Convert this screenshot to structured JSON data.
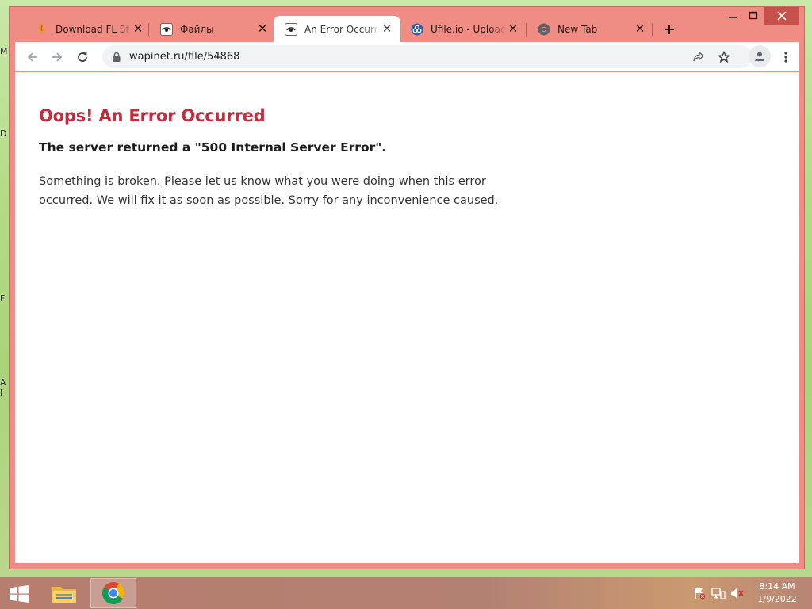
{
  "desktop": {
    "fragments": [
      "M",
      "D",
      "F",
      "A",
      "I"
    ]
  },
  "browser": {
    "tabs": [
      {
        "title": "Download FL Studio",
        "icon": "fl-studio-icon",
        "active": false
      },
      {
        "title": "Файлы",
        "icon": "wapinet-icon",
        "active": false
      },
      {
        "title": "An Error Occurred",
        "icon": "wapinet-icon",
        "active": true
      },
      {
        "title": "Ufile.io - Upload f",
        "icon": "ufile-icon",
        "active": false
      },
      {
        "title": "New Tab",
        "icon": "chrome-icon",
        "active": false
      }
    ],
    "new_tab_label": "+",
    "window_controls": {
      "minimize": "–",
      "maximize": "□",
      "close": "✕"
    },
    "address_bar": {
      "url": "wapinet.ru/file/54868"
    }
  },
  "page": {
    "title": "Oops! An Error Occurred",
    "subtitle": "The server returned a \"500 Internal Server Error\".",
    "body": "Something is broken. Please let us know what you were doing when this error occurred. We will fix it as soon as possible. Sorry for any inconvenience caused."
  },
  "taskbar": {
    "apps": [
      "file-explorer-icon",
      "chrome-icon"
    ],
    "tray": [
      "action-center-flag-icon",
      "network-icon",
      "volume-muted-icon"
    ],
    "clock": {
      "time": "8:14 AM",
      "date": "1/9/2022"
    }
  },
  "colors": {
    "chrome_frame": "#ef8d84",
    "error_title": "#c22d3e",
    "desktop": "#b4dc88"
  }
}
